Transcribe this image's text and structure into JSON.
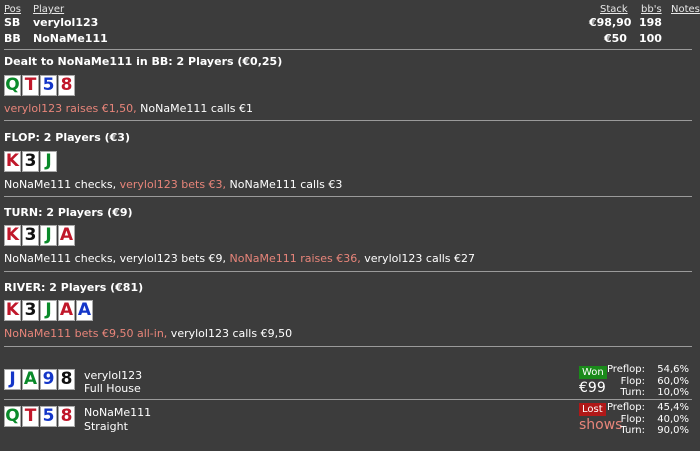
{
  "header": {
    "col_pos": "Pos",
    "col_player": "Player",
    "col_stack": "Stack",
    "col_bbs": "bb's",
    "col_notes": "Notes",
    "players": [
      {
        "pos": "SB",
        "name": "verylol123",
        "stack": "€98,90",
        "bbs": "198"
      },
      {
        "pos": "BB",
        "name": "NoNaMe111",
        "stack": "€50",
        "bbs": "100"
      }
    ]
  },
  "preflop": {
    "title": "Dealt to NoNaMe111 in BB: 2 Players (€0,25)",
    "cards": [
      "Q",
      "T",
      "5",
      "8"
    ],
    "actions": [
      {
        "text": "verylol123 raises €1,50,",
        "aggressive": true
      },
      {
        "text": " NoNaMe111 calls €1",
        "aggressive": false
      }
    ]
  },
  "flop": {
    "title": "FLOP: 2 Players (€3)",
    "cards": [
      "K",
      "3",
      "J"
    ],
    "actions": [
      {
        "text": "NoNaMe111 checks, ",
        "aggressive": false
      },
      {
        "text": "verylol123 bets €3,",
        "aggressive": true
      },
      {
        "text": " NoNaMe111 calls €3",
        "aggressive": false
      }
    ]
  },
  "turn": {
    "title": "TURN: 2 Players (€9)",
    "cards": [
      "K",
      "3",
      "J",
      "A"
    ],
    "actions": [
      {
        "text": "NoNaMe111 checks, verylol123 bets €9, ",
        "aggressive": false
      },
      {
        "text": "NoNaMe111 raises €36,",
        "aggressive": true
      },
      {
        "text": " verylol123 calls €27",
        "aggressive": false
      }
    ]
  },
  "river": {
    "title": "RIVER: 2 Players (€81)",
    "cards": [
      "K",
      "3",
      "J",
      "A",
      "A"
    ],
    "actions": [
      {
        "text": "NoNaMe111 bets €9,50 all-in,",
        "aggressive": true
      },
      {
        "text": " verylol123 calls €9,50",
        "aggressive": false
      }
    ]
  },
  "results": [
    {
      "cards": [
        "J",
        "A",
        "9",
        "8"
      ],
      "name": "verylol123",
      "hand": "Full House",
      "badge": "Won",
      "amount": "€99",
      "stats": [
        {
          "label": "Preflop:",
          "value": "54,6%"
        },
        {
          "label": "Flop:",
          "value": "60,0%"
        },
        {
          "label": "Turn:",
          "value": "10,0%"
        }
      ]
    },
    {
      "cards": [
        "Q",
        "T",
        "5",
        "8"
      ],
      "name": "NoNaMe111",
      "hand": "Straight",
      "badge": "Lost",
      "amount": "shows",
      "stats": [
        {
          "label": "Preflop:",
          "value": "45,4%"
        },
        {
          "label": "Flop:",
          "value": "40,0%"
        },
        {
          "label": "Turn:",
          "value": "90,0%"
        }
      ]
    }
  ],
  "colors": {
    "background": "#3c3c3c",
    "aggressive_action": "#e8857a",
    "won_badge": "#1a8a1a",
    "lost_badge": "#b01818",
    "suit_clubs": "#0a8a2a",
    "suit_hearts": "#c0172a",
    "suit_spades": "#111111",
    "suit_diamonds": "#1436c8"
  }
}
